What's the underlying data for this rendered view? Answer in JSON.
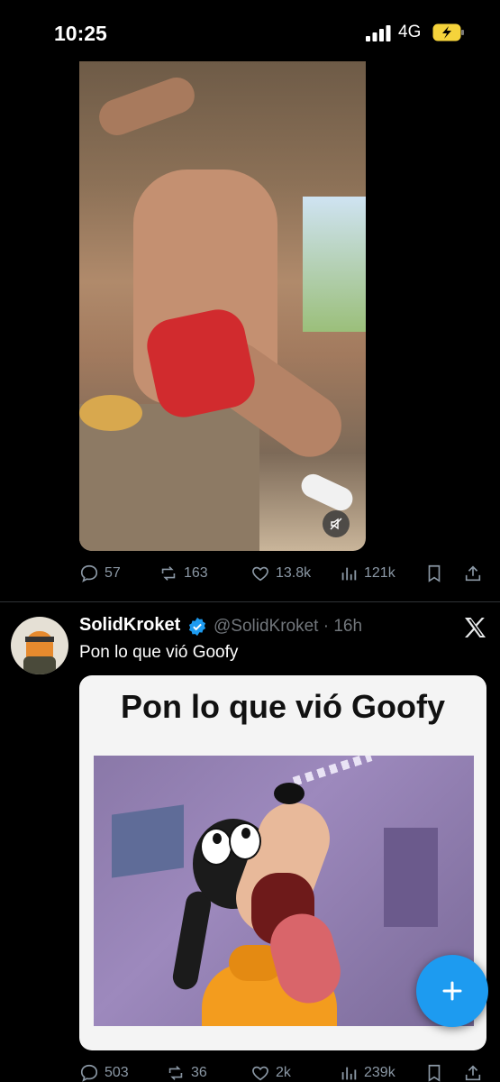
{
  "status_bar": {
    "time": "10:25",
    "network": "4G"
  },
  "post1": {
    "actions": {
      "replies": "57",
      "reposts": "163",
      "likes": "13.8k",
      "views": "121k"
    }
  },
  "post2": {
    "display_name": "SolidKroket",
    "handle_time": "@SolidKroket · 16h",
    "text": "Pon lo que vió Goofy",
    "meme_caption": "Pon lo que vió Goofy",
    "actions": {
      "replies": "503",
      "reposts": "36",
      "likes": "2k",
      "views": "239k"
    }
  },
  "colors": {
    "accent": "#1d9bf0",
    "muted": "#8b98a5",
    "background": "#000000"
  },
  "icons": [
    "signal-icon",
    "battery-charging-icon",
    "mute-icon",
    "reply-icon",
    "repost-icon",
    "like-icon",
    "views-icon",
    "bookmark-icon",
    "share-icon",
    "verified-icon",
    "x-logo-icon",
    "compose-plus-icon"
  ]
}
